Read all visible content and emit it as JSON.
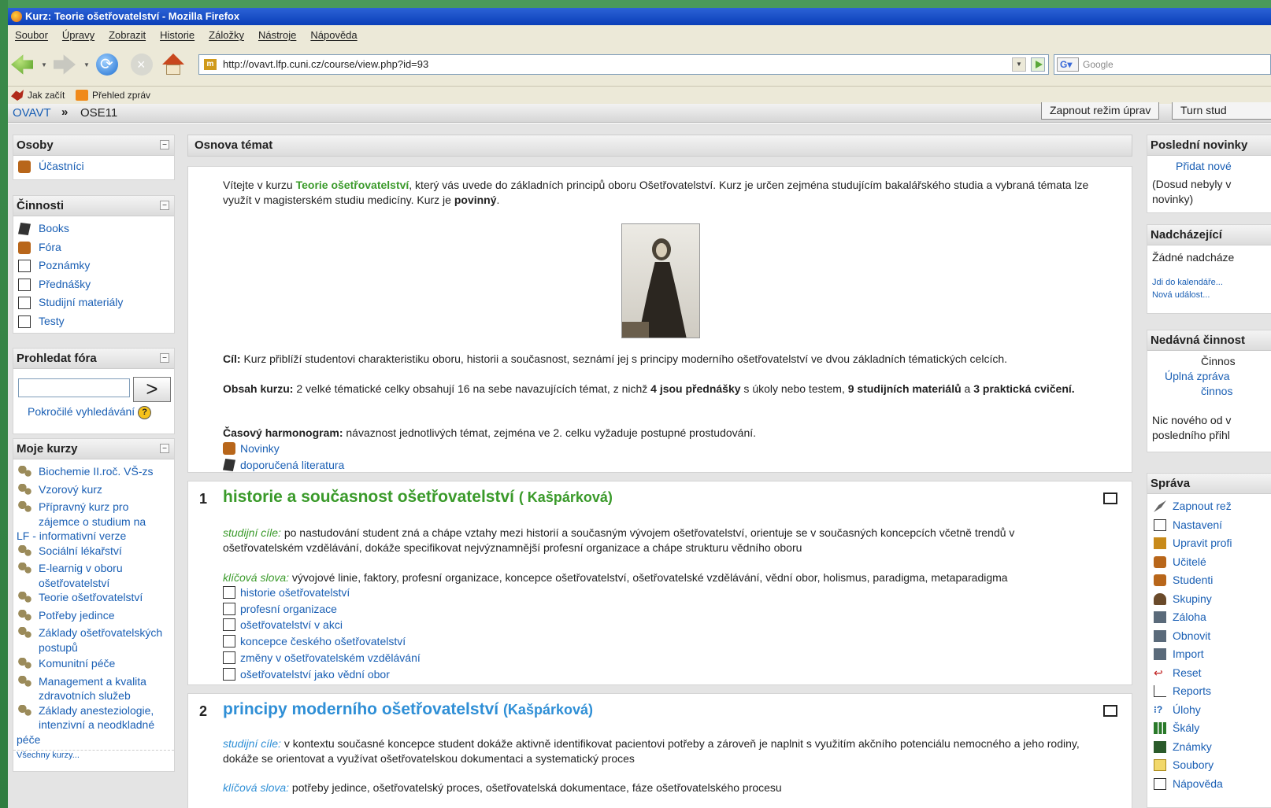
{
  "window": {
    "title": "Kurz: Teorie ošetřovatelství - Mozilla Firefox"
  },
  "menu": [
    "Soubor",
    "Úpravy",
    "Zobrazit",
    "Historie",
    "Záložky",
    "Nástroje",
    "Nápověda"
  ],
  "nav": {
    "url": "http://ovavt.lfp.cuni.cz/course/view.php?id=93",
    "search_placeholder": "Google",
    "search_engine_icon": "G"
  },
  "bookmarks": [
    "Jak začít",
    "Přehled zpráv"
  ],
  "moodle_nav": {
    "home": "OVAVT",
    "separator": "»",
    "course": "OSE11",
    "edit_button": "Zapnout režim úprav",
    "turn_button": "Turn stud"
  },
  "left": {
    "osoby": {
      "title": "Osoby",
      "items": [
        "Účastníci"
      ]
    },
    "cinnosti": {
      "title": "Činnosti",
      "items": [
        "Books",
        "Fóra",
        "Poznámky",
        "Přednášky",
        "Studijní materiály",
        "Testy"
      ]
    },
    "search": {
      "title": "Prohledat fóra",
      "go": ">",
      "advanced": "Pokročilé vyhledávání",
      "help": "?"
    },
    "kurzy": {
      "title": "Moje kurzy",
      "items": [
        "Biochemie II.roč. VŠ-zs",
        "Vzorový kurz",
        "Přípravný kurz pro zájemce o studium na",
        "LF - informativní verze",
        "Sociální lékařství",
        "E-learnig v oboru ošetřovatelství",
        "Teorie ošetřovatelství",
        "Potřeby jedince",
        "Základy ošetřovatelských postupů",
        "Komunitní péče",
        "Management a kvalita zdravotních služeb",
        "Základy anesteziologie, intenzivní a neodkladné",
        "péče"
      ],
      "all": "Všechny kurzy..."
    }
  },
  "center": {
    "header": "Osnova témat",
    "intro": {
      "p1_a": "Vítejte v kurzu ",
      "p1_course": "Teorie ošetřovatelství",
      "p1_b": ", který vás uvede do základních principů oboru Ošetřovatelství. Kurz je určen zejména studujícím bakalářského studia a vybraná témata lze využít v magisterském studiu medicíny. Kurz je ",
      "p1_bold": "povinný",
      "p1_end": ".",
      "goal_label": "Cíl:",
      "goal": " Kurz přiblíží studentovi charakteristiku oboru, historii a současnost, seznámí jej s principy moderního ošetřovatelství ve dvou základních tématických celcích.",
      "content_label": "Obsah kurzu:",
      "content_a": " 2 velké tématické celky obsahují 16 na sebe navazujících témat, z nichž ",
      "content_b": "4 jsou přednášky",
      "content_c": " s úkoly nebo testem, ",
      "content_d": "9 studijních materiálů",
      "content_e": " a ",
      "content_f": "3 praktická cvičení.",
      "time_label": "Časový harmonogram:",
      "time": " návaznost jednotlivých témat, zejména ve 2. celku vyžaduje postupné prostudování.",
      "links": [
        "Novinky",
        "doporučená literatura"
      ]
    },
    "sections": [
      {
        "num": "1",
        "title": "historie a současnost ošetřovatelství",
        "author": "( Kašpárková)",
        "goals_label": "studijní cíle:",
        "goals": " po nastudování student zná a chápe vztahy mezi historií a současným vývojem ošetřovatelství, orientuje se v současných koncepcích včetně trendů v ošetřovatelském vzdělávání, dokáže specifikovat nejvýznamnější profesní organizace a chápe strukturu vědního oboru",
        "keywords_label": "klíčová slova:",
        "keywords": " vývojové linie, faktory, profesní organizace, koncepce ošetřovatelství, ošetřovatelské vzdělávání, vědní obor, holismus, paradigma, metaparadigma",
        "resources": [
          "historie ošetřovatelství",
          "profesní organizace",
          "ošetřovatelství v akci",
          "koncepce českého ošetřovatelství",
          "změny v ošetřovatelském vzdělávání",
          "ošetřovatelství jako vědní obor"
        ]
      },
      {
        "num": "2",
        "title": "principy moderního ošetřovatelství",
        "author": "(Kašpárková)",
        "goals_label": "studijní cíle:",
        "goals": " v kontextu současné koncepce student dokáže aktivně identifikovat pacientovi potřeby a zároveň je naplnit s využitím akčního potenciálu nemocného a jeho rodiny, dokáže se orientovat a využívat ošetřovatelskou dokumentaci a systematický proces",
        "keywords_label": "klíčová slova:",
        "keywords": " potřeby jedince, ošetřovatelský proces, ošetřovatelská dokumentace, fáze ošetřovatelského procesu"
      }
    ]
  },
  "right": {
    "news": {
      "title": "Poslední novinky",
      "add": "Přidat nové",
      "none": "(Dosud nebyly v",
      "none2": "novinky)"
    },
    "events": {
      "title": "Nadcházející",
      "none": "Žádné nadcháze",
      "cal": "Jdi do kalendáře...",
      "new": "Nová událost..."
    },
    "recent": {
      "title": "Nedávná činnost",
      "l1": "Činnos",
      "l2": "Úplná zpráva",
      "l3": "činnos",
      "l4": "Nic nového od v",
      "l5": "posledního přihl"
    },
    "admin": {
      "title": "Správa",
      "items": [
        "Zapnout rež",
        "Nastavení",
        "Upravit profi",
        "Učitelé",
        "Studenti",
        "Skupiny",
        "Záloha",
        "Obnovit",
        "Import",
        "Reset",
        "Reports",
        "Úlohy",
        "Škály",
        "Známky",
        "Soubory",
        "Nápověda"
      ]
    }
  }
}
